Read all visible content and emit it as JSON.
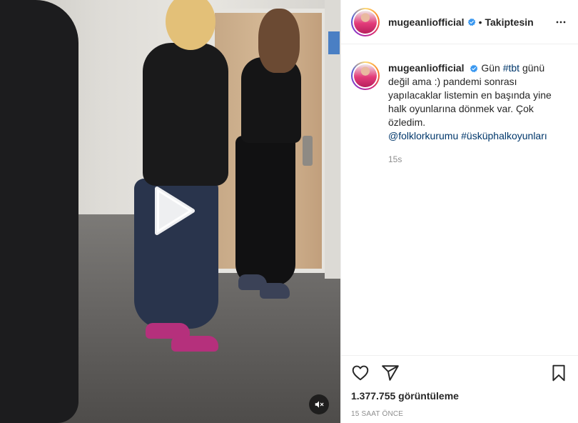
{
  "post": {
    "username": "mugeanliofficial",
    "follow_status": "Takiptesin",
    "separator": "•",
    "caption": {
      "username": "mugeanliofficial",
      "text_1": "Gün ",
      "hashtag_1": "#tbt",
      "text_2": " günü değil ama :) pandemi sonrası yapılacaklar listemin en başında yine halk oyunlarına dönmek var. Çok özledim.",
      "mention": "@folklorkurumu",
      "hashtag_2": "#üsküphalkoyunları",
      "time": "15s"
    },
    "views": "1.377.755 görüntüleme",
    "posted_ago": "15 SAAT ÖNCE"
  },
  "icons": {
    "verified": "verified-badge-icon",
    "more": "more-options-icon",
    "play": "play-icon",
    "mute": "sound-off-icon",
    "like": "heart-icon",
    "share": "paper-plane-icon",
    "save": "bookmark-icon"
  },
  "colors": {
    "verified": "#3897f0",
    "link": "#00376b",
    "secondary_text": "#8e8e8e"
  }
}
